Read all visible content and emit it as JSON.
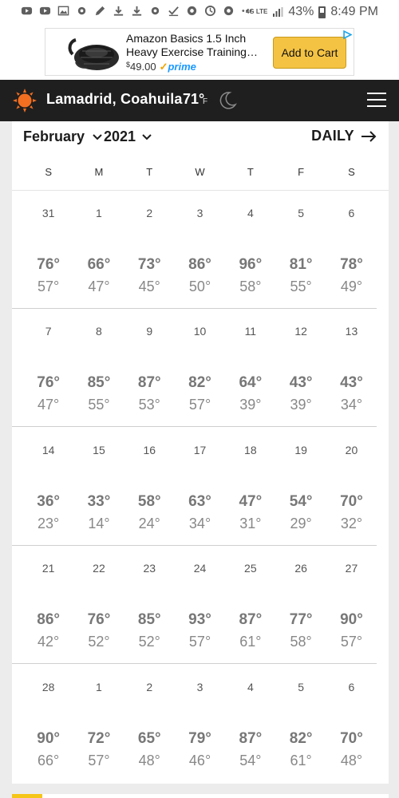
{
  "status_bar": {
    "battery": "43%",
    "time": "8:49 PM",
    "network": "4G LTE",
    "icons": [
      "youtube-icon",
      "youtube-icon",
      "image-icon",
      "settings-icon",
      "pen-icon",
      "download-icon",
      "download-icon",
      "settings-icon",
      "check-icon",
      "gear-icon",
      "sync-icon",
      "gear-icon",
      "more-dots-icon"
    ]
  },
  "ad": {
    "title": "Amazon Basics 1.5 Inch Heavy Exercise Training…",
    "currency": "$",
    "price": "49.00",
    "prime_label": "prime",
    "cta": "Add to Cart"
  },
  "header": {
    "location": "Lamadrid, Coahuila",
    "temp": "71°",
    "unit": "F",
    "accent": "#f26f21",
    "background": "#1f1f1f"
  },
  "calendar": {
    "month": "February",
    "year": "2021",
    "view_link": "DAILY",
    "weekdays": [
      "S",
      "M",
      "T",
      "W",
      "T",
      "F",
      "S"
    ],
    "weeks": [
      {
        "days": [
          {
            "num": "31",
            "hi": "76°",
            "lo": "57°"
          },
          {
            "num": "1",
            "hi": "66°",
            "lo": "47°"
          },
          {
            "num": "2",
            "hi": "73°",
            "lo": "45°"
          },
          {
            "num": "3",
            "hi": "86°",
            "lo": "50°"
          },
          {
            "num": "4",
            "hi": "96°",
            "lo": "58°"
          },
          {
            "num": "5",
            "hi": "81°",
            "lo": "55°"
          },
          {
            "num": "6",
            "hi": "78°",
            "lo": "49°"
          }
        ]
      },
      {
        "days": [
          {
            "num": "7",
            "hi": "76°",
            "lo": "47°"
          },
          {
            "num": "8",
            "hi": "85°",
            "lo": "55°"
          },
          {
            "num": "9",
            "hi": "87°",
            "lo": "53°"
          },
          {
            "num": "10",
            "hi": "82°",
            "lo": "57°"
          },
          {
            "num": "11",
            "hi": "64°",
            "lo": "39°"
          },
          {
            "num": "12",
            "hi": "43°",
            "lo": "39°"
          },
          {
            "num": "13",
            "hi": "43°",
            "lo": "34°"
          }
        ]
      },
      {
        "days": [
          {
            "num": "14",
            "hi": "36°",
            "lo": "23°"
          },
          {
            "num": "15",
            "hi": "33°",
            "lo": "14°"
          },
          {
            "num": "16",
            "hi": "58°",
            "lo": "24°"
          },
          {
            "num": "17",
            "hi": "63°",
            "lo": "34°"
          },
          {
            "num": "18",
            "hi": "47°",
            "lo": "31°"
          },
          {
            "num": "19",
            "hi": "54°",
            "lo": "29°"
          },
          {
            "num": "20",
            "hi": "70°",
            "lo": "32°"
          }
        ]
      },
      {
        "days": [
          {
            "num": "21",
            "hi": "86°",
            "lo": "42°"
          },
          {
            "num": "22",
            "hi": "76°",
            "lo": "52°"
          },
          {
            "num": "23",
            "hi": "85°",
            "lo": "52°"
          },
          {
            "num": "24",
            "hi": "93°",
            "lo": "57°"
          },
          {
            "num": "25",
            "hi": "87°",
            "lo": "61°"
          },
          {
            "num": "26",
            "hi": "77°",
            "lo": "58°"
          },
          {
            "num": "27",
            "hi": "90°",
            "lo": "57°"
          }
        ]
      },
      {
        "days": [
          {
            "num": "28",
            "hi": "90°",
            "lo": "66°"
          },
          {
            "num": "1",
            "hi": "72°",
            "lo": "57°"
          },
          {
            "num": "2",
            "hi": "65°",
            "lo": "48°"
          },
          {
            "num": "3",
            "hi": "79°",
            "lo": "46°"
          },
          {
            "num": "4",
            "hi": "87°",
            "lo": "54°"
          },
          {
            "num": "5",
            "hi": "82°",
            "lo": "61°"
          },
          {
            "num": "6",
            "hi": "70°",
            "lo": "48°"
          }
        ]
      }
    ]
  }
}
